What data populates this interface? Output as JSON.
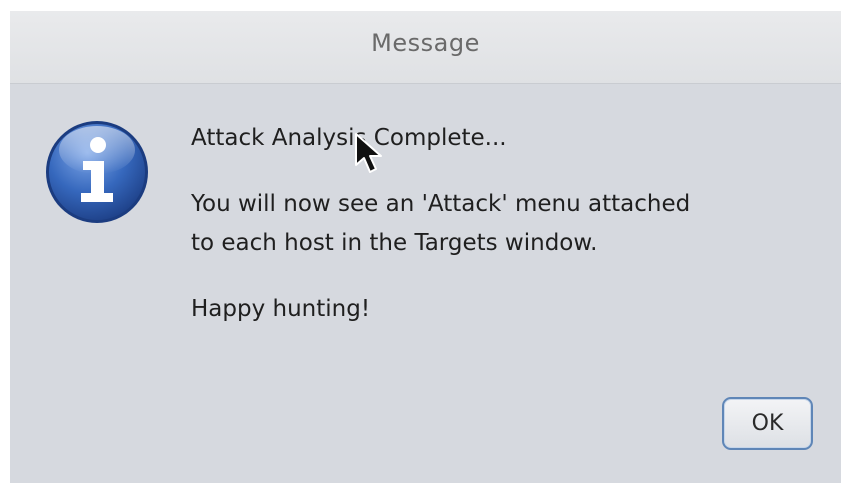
{
  "dialog": {
    "title": "Message",
    "icon": "info-icon",
    "message_lines": [
      "Attack Analysis Complete...",
      "You will now see an 'Attack' menu attached",
      "to each host in the Targets window.",
      "Happy hunting!"
    ],
    "ok_label": "OK"
  },
  "cursor": {
    "icon": "mouse-pointer-icon"
  },
  "colors": {
    "dialog_background": "#d6d9df",
    "title_text": "#6a6a6a",
    "button_border": "#5f86b7",
    "info_icon_blue": "#2f62b5"
  }
}
